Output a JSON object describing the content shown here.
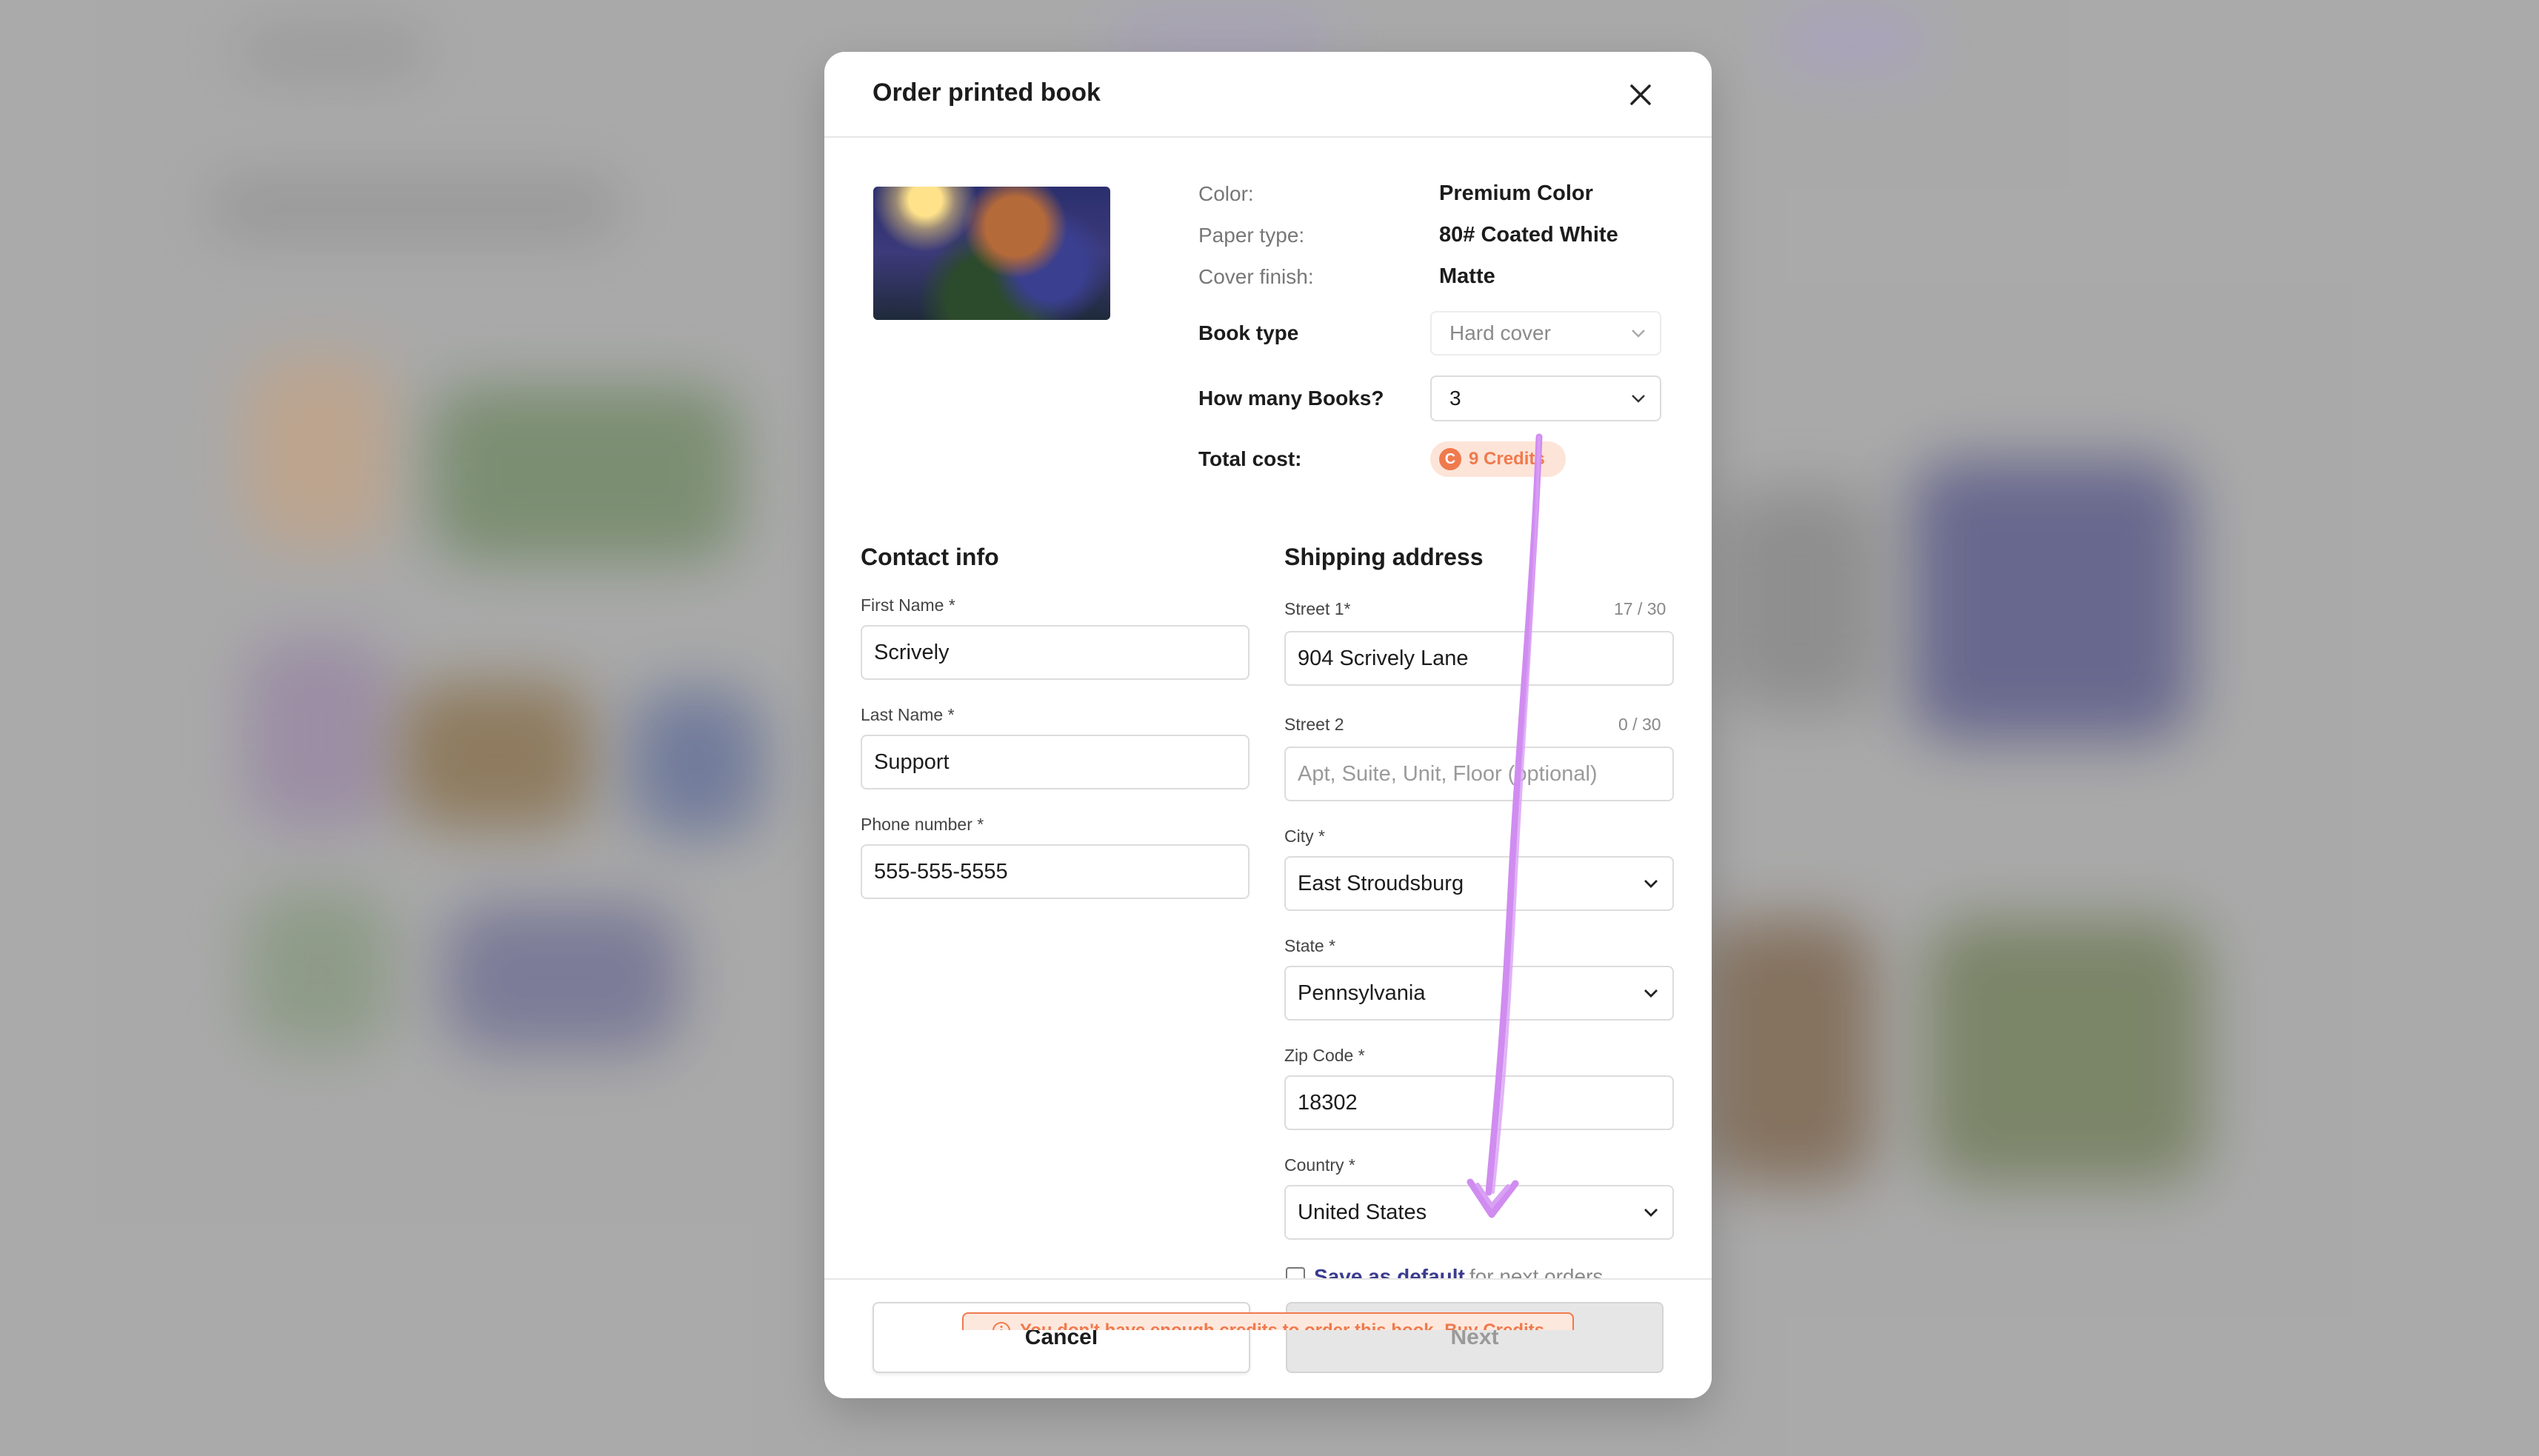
{
  "modal": {
    "title": "Order printed book"
  },
  "book_specs": {
    "color_label": "Color:",
    "color_value": "Premium Color",
    "paper_label": "Paper type:",
    "paper_value": "80# Coated White",
    "finish_label": "Cover finish:",
    "finish_value": "Matte"
  },
  "book_type": {
    "label": "Book type",
    "value": "Hard cover"
  },
  "quantity": {
    "label": "How many Books?",
    "value": "3"
  },
  "total": {
    "label": "Total cost:",
    "credits_icon": "C",
    "credits": "9 Credits"
  },
  "contact": {
    "title": "Contact info",
    "first_name_label": "First Name *",
    "first_name": "Scrively",
    "last_name_label": "Last Name *",
    "last_name": "Support",
    "phone_label": "Phone number *",
    "phone": "555-555-5555"
  },
  "shipping": {
    "title": "Shipping address",
    "street1_label": "Street 1*",
    "street1_counter": "17 / 30",
    "street1": "904 Scrively Lane",
    "street2_label": "Street 2",
    "street2_counter": "0 / 30",
    "street2_placeholder": "Apt, Suite, Unit, Floor (optional)",
    "city_label": "City *",
    "city": "East Stroudsburg",
    "state_label": "State *",
    "state": "Pennsylvania",
    "zip_label": "Zip Code *",
    "zip": "18302",
    "country_label": "Country *",
    "country": "United States",
    "save_default_link": "Save as default",
    "save_default_rest": "for next orders"
  },
  "warning": {
    "message": "You don't have enough credits to order this book.",
    "buy_link": "Buy Credits"
  },
  "footer": {
    "cancel": "Cancel",
    "next": "Next"
  },
  "colors": {
    "accent_orange": "#ef7a4d",
    "annotation_purple": "#d08cf0"
  },
  "icons": [
    "close-icon",
    "chevron-down-icon",
    "credits-coin-icon",
    "info-icon"
  ]
}
